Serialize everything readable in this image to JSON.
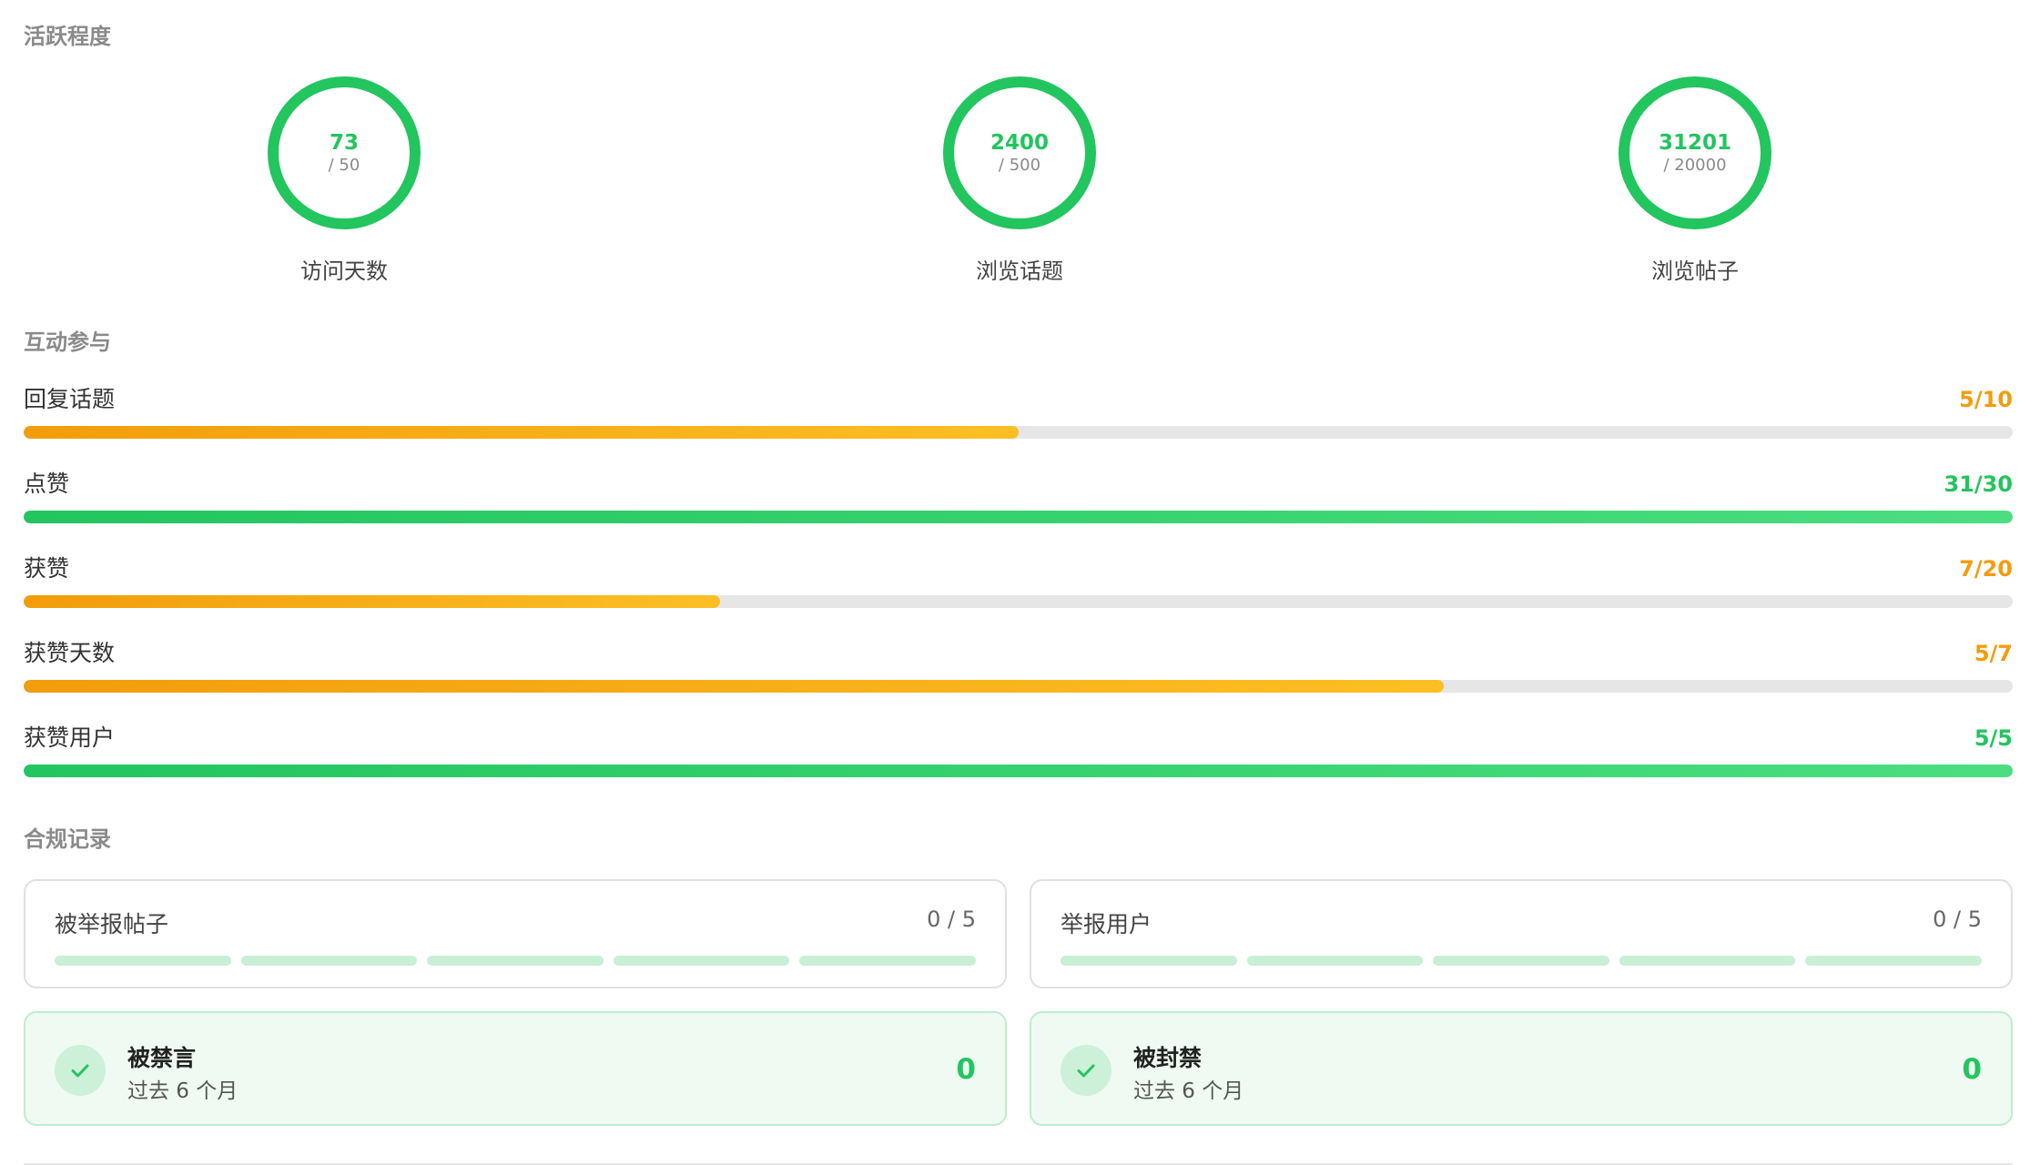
{
  "activity": {
    "title": "活跃程度",
    "circles": [
      {
        "value": "73",
        "target": "/ 50",
        "label": "访问天数"
      },
      {
        "value": "2400",
        "target": "/ 500",
        "label": "浏览话题"
      },
      {
        "value": "31201",
        "target": "/ 20000",
        "label": "浏览帖子"
      }
    ]
  },
  "interaction": {
    "title": "互动参与",
    "rows": [
      {
        "label": "回复话题",
        "value": "5/10",
        "progress": 0.5,
        "status": "orange"
      },
      {
        "label": "点赞",
        "value": "31/30",
        "progress": 1.0,
        "status": "green"
      },
      {
        "label": "获赞",
        "value": "7/20",
        "progress": 0.35,
        "status": "orange"
      },
      {
        "label": "获赞天数",
        "value": "5/7",
        "progress": 0.714,
        "status": "orange"
      },
      {
        "label": "获赞用户",
        "value": "5/5",
        "progress": 1.0,
        "status": "green"
      }
    ]
  },
  "compliance": {
    "title": "合规记录",
    "cards": [
      {
        "label": "被举报帖子",
        "count": "0 / 5",
        "filled": 0,
        "total": 5
      },
      {
        "label": "举报用户",
        "count": "0 / 5",
        "filled": 0,
        "total": 5
      }
    ],
    "status": [
      {
        "title": "被禁言",
        "subtitle": "过去 6 个月",
        "count": "0"
      },
      {
        "title": "被封禁",
        "subtitle": "过去 6 个月",
        "count": "0"
      }
    ]
  },
  "colors": {
    "green": "#22c55e",
    "orange": "#f29d0c",
    "muted_title": "#8a8a8a"
  }
}
